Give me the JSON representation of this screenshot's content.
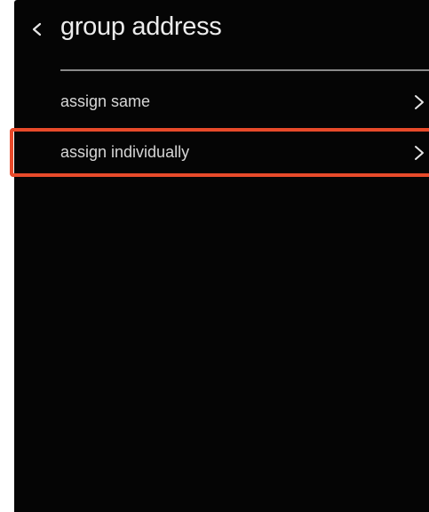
{
  "header": {
    "back_icon": "chevron-left-icon",
    "title": "group address"
  },
  "menu": {
    "items": [
      {
        "label": "assign same",
        "icon": "chevron-right-icon"
      },
      {
        "label": "assign individually",
        "icon": "chevron-right-icon",
        "highlighted": true
      }
    ]
  },
  "colors": {
    "background": "#050505",
    "text": "#e9e9e9",
    "divider": "#8a8a8a",
    "highlight": "#e84a2a"
  }
}
